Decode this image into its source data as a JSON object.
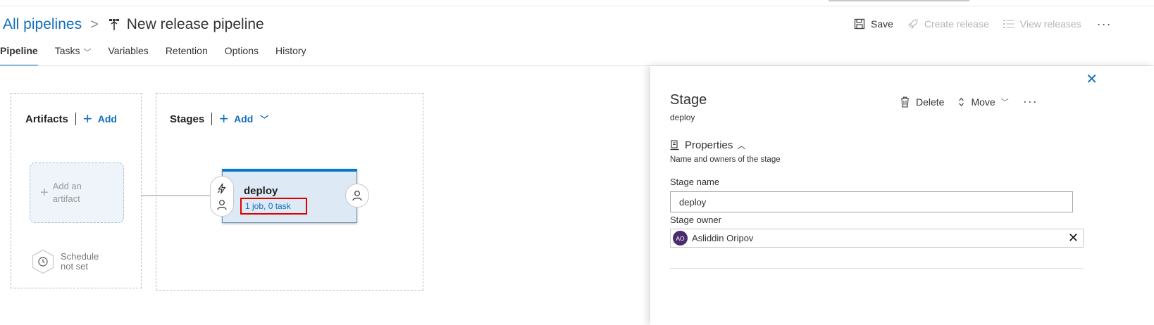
{
  "breadcrumb": {
    "root": "All pipelines",
    "separator": ">",
    "title": "New release pipeline"
  },
  "toolbar": {
    "save": "Save",
    "create_release": "Create release",
    "view_releases": "View releases",
    "more": "···"
  },
  "tabs": [
    {
      "label": "Pipeline",
      "active": true
    },
    {
      "label": "Tasks",
      "dropdown": true
    },
    {
      "label": "Variables"
    },
    {
      "label": "Retention"
    },
    {
      "label": "Options"
    },
    {
      "label": "History"
    }
  ],
  "canvas": {
    "artifacts": {
      "title": "Artifacts",
      "add": "Add",
      "card_line1": "Add an",
      "card_line2": "artifact",
      "schedule_line1": "Schedule",
      "schedule_line2": "not set"
    },
    "stages": {
      "title": "Stages",
      "add": "Add"
    },
    "stage_card": {
      "name": "deploy",
      "summary": "1 job, 0 task"
    }
  },
  "panel": {
    "close": "✕",
    "title": "Stage",
    "subtitle": "deploy",
    "actions": {
      "delete": "Delete",
      "move": "Move",
      "more": "···"
    },
    "properties": {
      "title": "Properties",
      "description": "Name and owners of the stage"
    },
    "stage_name": {
      "label": "Stage name",
      "value": "deploy"
    },
    "stage_owner": {
      "label": "Stage owner",
      "initials": "AO",
      "name": "Asliddin Oripov",
      "clear": "✕"
    }
  },
  "colors": {
    "accent": "#0078d4",
    "link": "#106ebe",
    "highlight": "#e00000",
    "avatar": "#4b2c6e",
    "stage_bg": "#dde9f5"
  }
}
